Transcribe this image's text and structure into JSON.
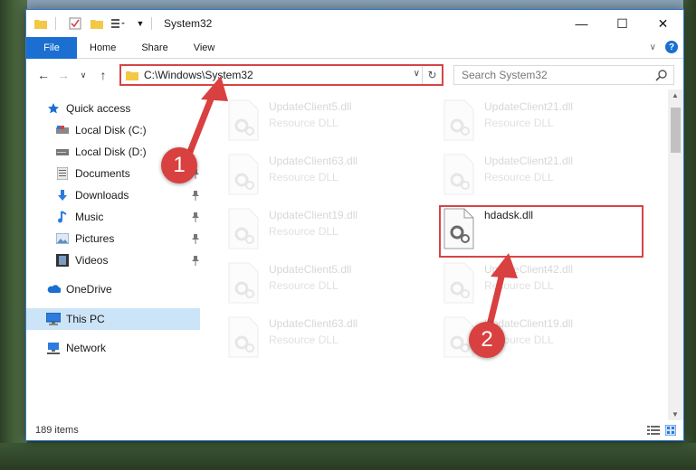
{
  "window": {
    "title": "System32",
    "controls": {
      "minimize": "—",
      "maximize": "☐",
      "close": "✕"
    }
  },
  "ribbon": {
    "file": "File",
    "tabs": [
      "Home",
      "Share",
      "View"
    ]
  },
  "navigation": {
    "address": "C:\\Windows\\System32",
    "search_placeholder": "Search System32"
  },
  "sidebar": {
    "items": [
      {
        "label": "Quick access",
        "icon": "star-icon",
        "pinned": false
      },
      {
        "label": "Local Disk (C:)",
        "icon": "drive-icon",
        "pinned": false
      },
      {
        "label": "Local Disk (D:)",
        "icon": "drive-icon",
        "pinned": false
      },
      {
        "label": "Documents",
        "icon": "documents-icon",
        "pinned": true
      },
      {
        "label": "Downloads",
        "icon": "download-icon",
        "pinned": true
      },
      {
        "label": "Music",
        "icon": "music-icon",
        "pinned": true
      },
      {
        "label": "Pictures",
        "icon": "pictures-icon",
        "pinned": true
      },
      {
        "label": "Videos",
        "icon": "videos-icon",
        "pinned": true
      },
      {
        "label": "OneDrive",
        "icon": "cloud-icon",
        "pinned": false
      },
      {
        "label": "This PC",
        "icon": "computer-icon",
        "pinned": false,
        "selected": true
      },
      {
        "label": "Network",
        "icon": "network-icon",
        "pinned": false
      }
    ]
  },
  "files": [
    {
      "name": "UpdateClient5.dll",
      "type": "Resource DLL",
      "faded": true
    },
    {
      "name": "UpdateClient21.dll",
      "type": "Resource DLL",
      "faded": true
    },
    {
      "name": "UpdateClient63.dll",
      "type": "Resource DLL",
      "faded": true
    },
    {
      "name": "UpdateClient21.dll",
      "type": "Resource DLL",
      "faded": true
    },
    {
      "name": "UpdateClient19.dll",
      "type": "Resource DLL",
      "faded": true
    },
    {
      "name": "hdadsk.dll",
      "type": "",
      "faded": false
    },
    {
      "name": "UpdateClient5.dll",
      "type": "Resource DLL",
      "faded": true
    },
    {
      "name": "UpdateClient42.dll",
      "type": "Resource DLL",
      "faded": true
    },
    {
      "name": "UpdateClient63.dll",
      "type": "Resource DLL",
      "faded": true
    },
    {
      "name": "UpdateClient19.dll",
      "type": "Resource DLL",
      "faded": true
    }
  ],
  "status": {
    "item_count": "189 items"
  },
  "annotations": {
    "step1": "1",
    "step2": "2",
    "color": "#d64545"
  }
}
